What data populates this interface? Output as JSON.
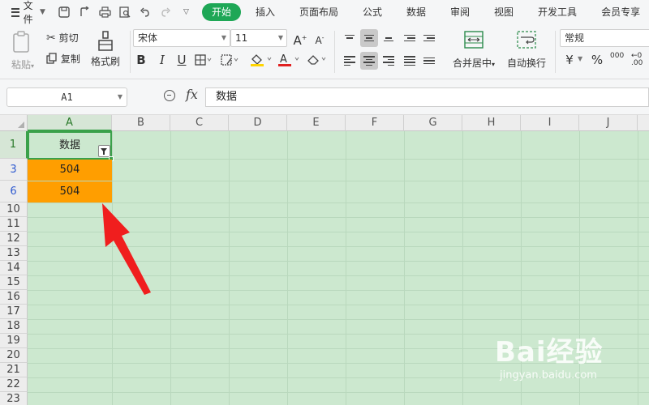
{
  "menubar": {
    "file_label": "文件",
    "tabs": [
      {
        "label": "开始",
        "active": true
      },
      {
        "label": "插入"
      },
      {
        "label": "页面布局"
      },
      {
        "label": "公式"
      },
      {
        "label": "数据"
      },
      {
        "label": "审阅"
      },
      {
        "label": "视图"
      },
      {
        "label": "开发工具"
      },
      {
        "label": "会员专享"
      }
    ]
  },
  "ribbon": {
    "paste_label": "粘贴",
    "cut_label": "剪切",
    "copy_label": "复制",
    "format_painter_label": "格式刷",
    "font_name": "宋体",
    "font_size": "11",
    "bold": "B",
    "italic": "I",
    "underline": "U",
    "merge_center_label": "合并居中",
    "wrap_text_label": "自动换行",
    "number_format": "常规",
    "currency_symbol": "¥",
    "percent_symbol": "%",
    "thousands_symbol": "000",
    "font_color": "#e02020",
    "fill_color": "#ffd400"
  },
  "formula_bar": {
    "name_box": "A1",
    "fx_label": "fx",
    "content": "数据"
  },
  "sheet": {
    "columns": [
      "A",
      "B",
      "C",
      "D",
      "E",
      "F",
      "G",
      "H",
      "I",
      "J"
    ],
    "rows": [
      "1",
      "3",
      "6",
      "10",
      "11",
      "12",
      "13",
      "14",
      "15",
      "16",
      "17",
      "18",
      "19",
      "20",
      "21",
      "22",
      "23"
    ],
    "cells": {
      "A1": "数据",
      "A3": "504",
      "A6": "504"
    },
    "highlight_color": "#ff9e00",
    "grid_bg": "#cce8cf"
  },
  "watermark": {
    "logo": "Bai经验",
    "url": "jingyan.baidu.com"
  }
}
